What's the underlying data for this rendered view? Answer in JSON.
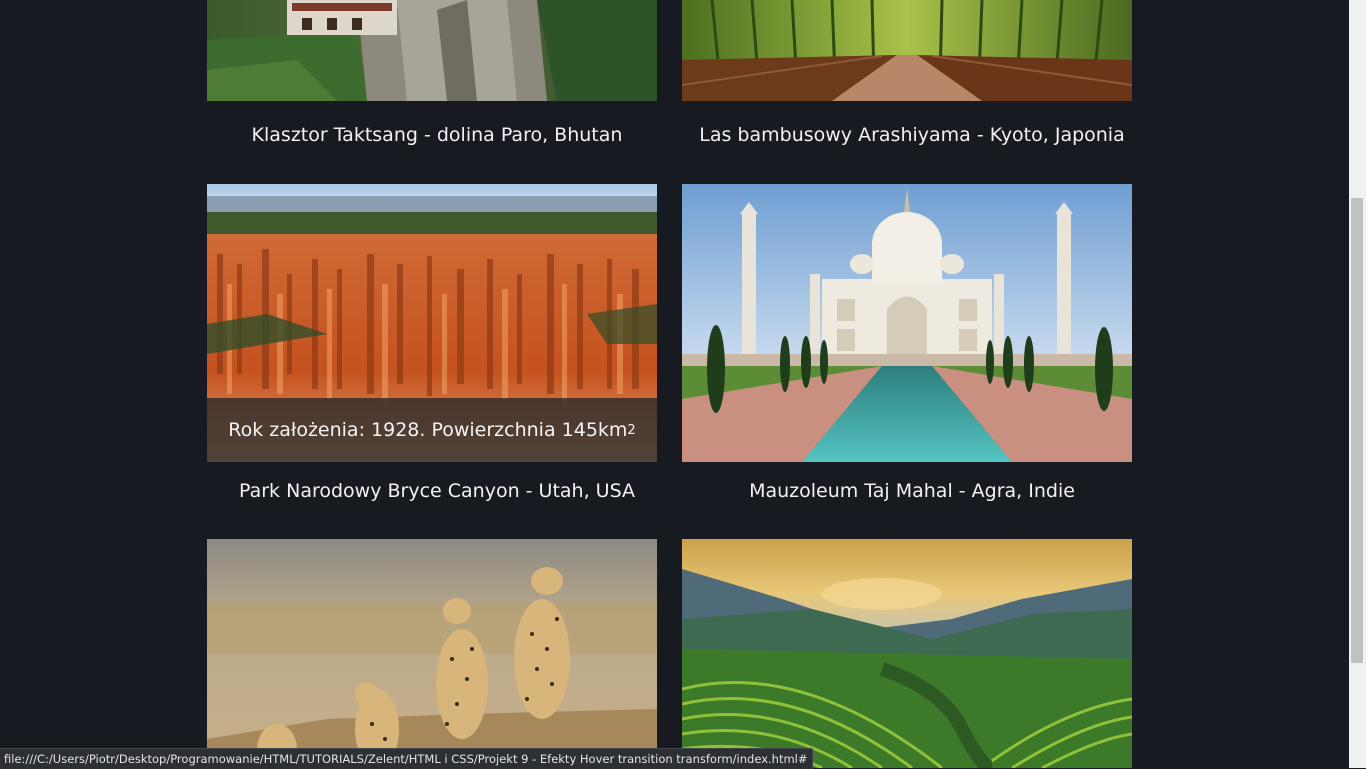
{
  "gallery": {
    "items": [
      {
        "caption": "Klasztor Taktsang - dolina Paro, Bhutan"
      },
      {
        "caption": "Las bambusowy Arashiyama - Kyoto, Japonia"
      },
      {
        "caption": "Park Narodowy Bryce Canyon - Utah, USA",
        "hover_text": "Rok założenia: 1928. Powierzchnia 145km",
        "hover_sup": "2"
      },
      {
        "caption": "Mauzoleum Taj Mahal - Agra, Indie"
      },
      {
        "caption": ""
      },
      {
        "caption": ""
      }
    ]
  },
  "status_bar": {
    "url": "file:///C:/Users/Piotr/Desktop/Programowanie/HTML/TUTORIALS/Zelent/HTML i CSS/Projekt 9 - Efekty Hover transition transform/index.html#"
  },
  "colors": {
    "background": "#171b21",
    "caption_text": "#f1f1f1",
    "overlay": "rgba(40,40,40,0.78)"
  }
}
